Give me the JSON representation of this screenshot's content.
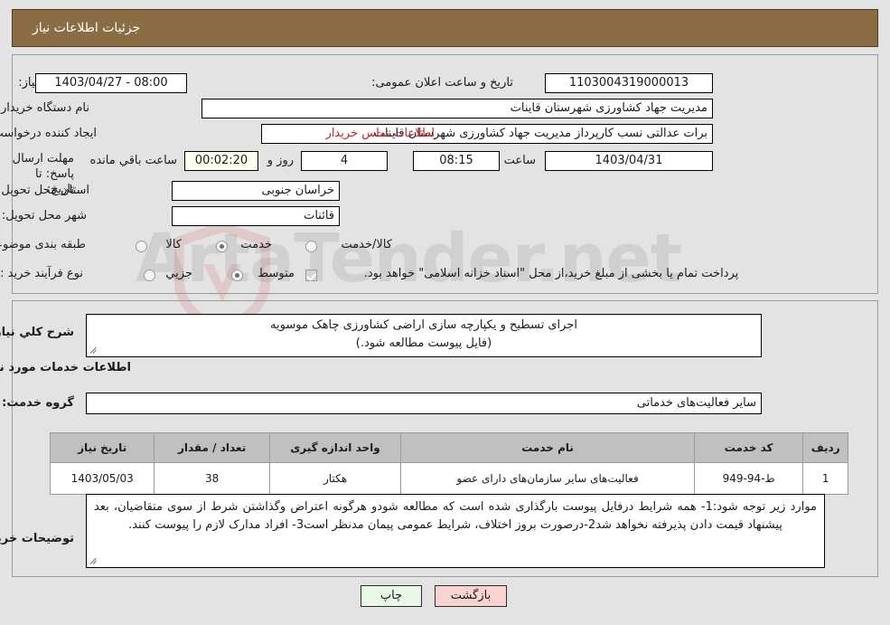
{
  "header": {
    "title": "جزئیات اطلاعات نیاز"
  },
  "form": {
    "need_number_label": "شماره نیاز:",
    "need_number_value": "1103004319000013",
    "public_announce_label": "تاریخ و ساعت اعلان عمومی:",
    "public_announce_value": "08:00 - 1403/04/27",
    "buyer_org_label": "نام دستگاه خریدار:",
    "buyer_org_value": "مدیریت جهاد کشاورزی شهرستان قاینات",
    "requester_label": "ایجاد کننده درخواست:",
    "requester_value": "برات عدالتی نسب کارپرداز مدیریت جهاد کشاورزی شهرستان قاینات",
    "contact_link": "اطلاعات تماس خریدار",
    "deadline_label": "مهلت ارسال پاسخ: تا تاریخ:",
    "deadline_date": "1403/04/31",
    "hour_label": "ساعت",
    "deadline_time": "08:15",
    "days_remaining": "4",
    "days_word": "روز و",
    "time_remaining": "00:02:20",
    "remaining_suffix": "ساعت باقي مانده",
    "province_label": "استان محل تحویل:",
    "province_value": "خراسان جنوبی",
    "city_label": "شهر محل تحویل:",
    "city_value": "قائنات",
    "category_label": "طبقه بندی موضوعی:",
    "category_options": [
      "کالا",
      "خدمت",
      "کالا/خدمت"
    ],
    "category_selected": "خدمت",
    "process_label": "نوع فرآیند خرید :",
    "process_options": [
      "جزیي",
      "متوسط"
    ],
    "process_selected": "متوسط",
    "treasury_checkbox_label": "پرداخت تمام یا بخشی از مبلغ خرید،از محل \"اسناد خزانه اسلامی\" خواهد بود.",
    "treasury_checked": true
  },
  "description": {
    "label": "شرح کلي نیاز:",
    "line1": "اجرای تسطیح و یکپارچه سازی اراضی کشاورزی چاهک موسویه",
    "line2": "(فایل پیوست مطالعه شود.)"
  },
  "services": {
    "section_title": "اطلاعات خدمات مورد نیاز",
    "group_label": "گروه خدمت:",
    "group_value": "سایر فعالیت‌های خدماتی",
    "columns": [
      "ردیف",
      "کد خدمت",
      "نام خدمت",
      "واحد اندازه گیری",
      "تعداد / مقدار",
      "تاریخ نیاز"
    ],
    "rows": [
      {
        "row": "1",
        "code": "ط-94-949",
        "name": "فعالیت‌های سایر سازمان‌های دارای عضو",
        "unit": "هکتار",
        "quantity": "38",
        "need_date": "1403/05/03"
      }
    ]
  },
  "notes": {
    "label": "توضیحات خریدار:",
    "text": "موارد زیر توجه شود:1- همه شرایط درفایل پیوست بارگذاری شده است که مطالعه شودو هرگونه اعتراض وگذاشتن شرط از سوی متقاضیان، بعد پیشنهاد قیمت دادن پذیرفته نخواهد شد2-درصورت بروز اختلاف، شرایط عمومی پیمان مدنظر است3- افراد مدارک لازم را پیوست کنند."
  },
  "footer": {
    "print_label": "چاپ",
    "back_label": "بازگشت"
  },
  "watermark": {
    "text": "ArtaTender.net"
  }
}
